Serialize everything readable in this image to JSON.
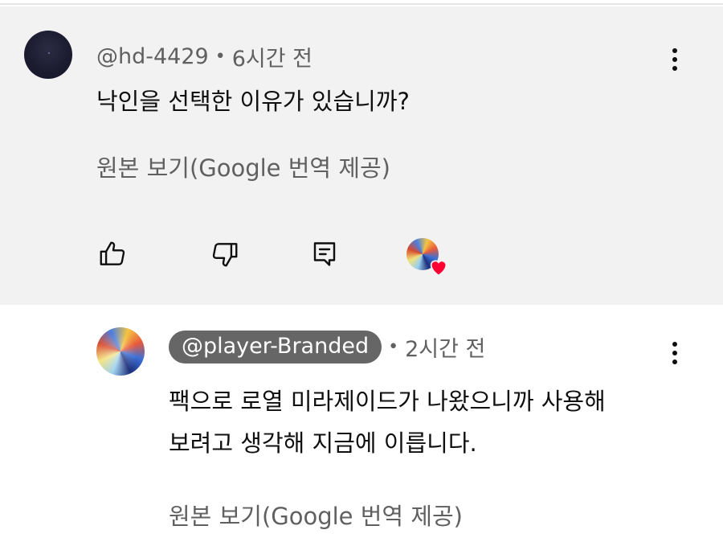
{
  "parent_comment": {
    "handle": "@hd-4429",
    "time": "6시간 전",
    "text": "낙인을 선택한 이유가 있습니까?",
    "translation_link": "원본 보기(Google 번역 제공)",
    "avatar_icon": "dark-avatar",
    "actions": [
      "like-icon",
      "dislike-icon",
      "reply-icon",
      "creator-heart-icon"
    ]
  },
  "reply_comment": {
    "handle": "@player-Branded",
    "time": "2시간 전",
    "text_line1": "팩으로 로열 미라제이드가 나왔으니까 사용해",
    "text_line2": "보려고 생각해 지금에 이릅니다.",
    "translation_link": "원본 보기(Google 번역 제공)",
    "avatar_icon": "creator-avatar"
  },
  "separator": "•",
  "colors": {
    "parent_bg": "#f2f2f2",
    "chip_bg": "#666666",
    "secondary_text": "#606060",
    "heart": "#ff0033"
  }
}
